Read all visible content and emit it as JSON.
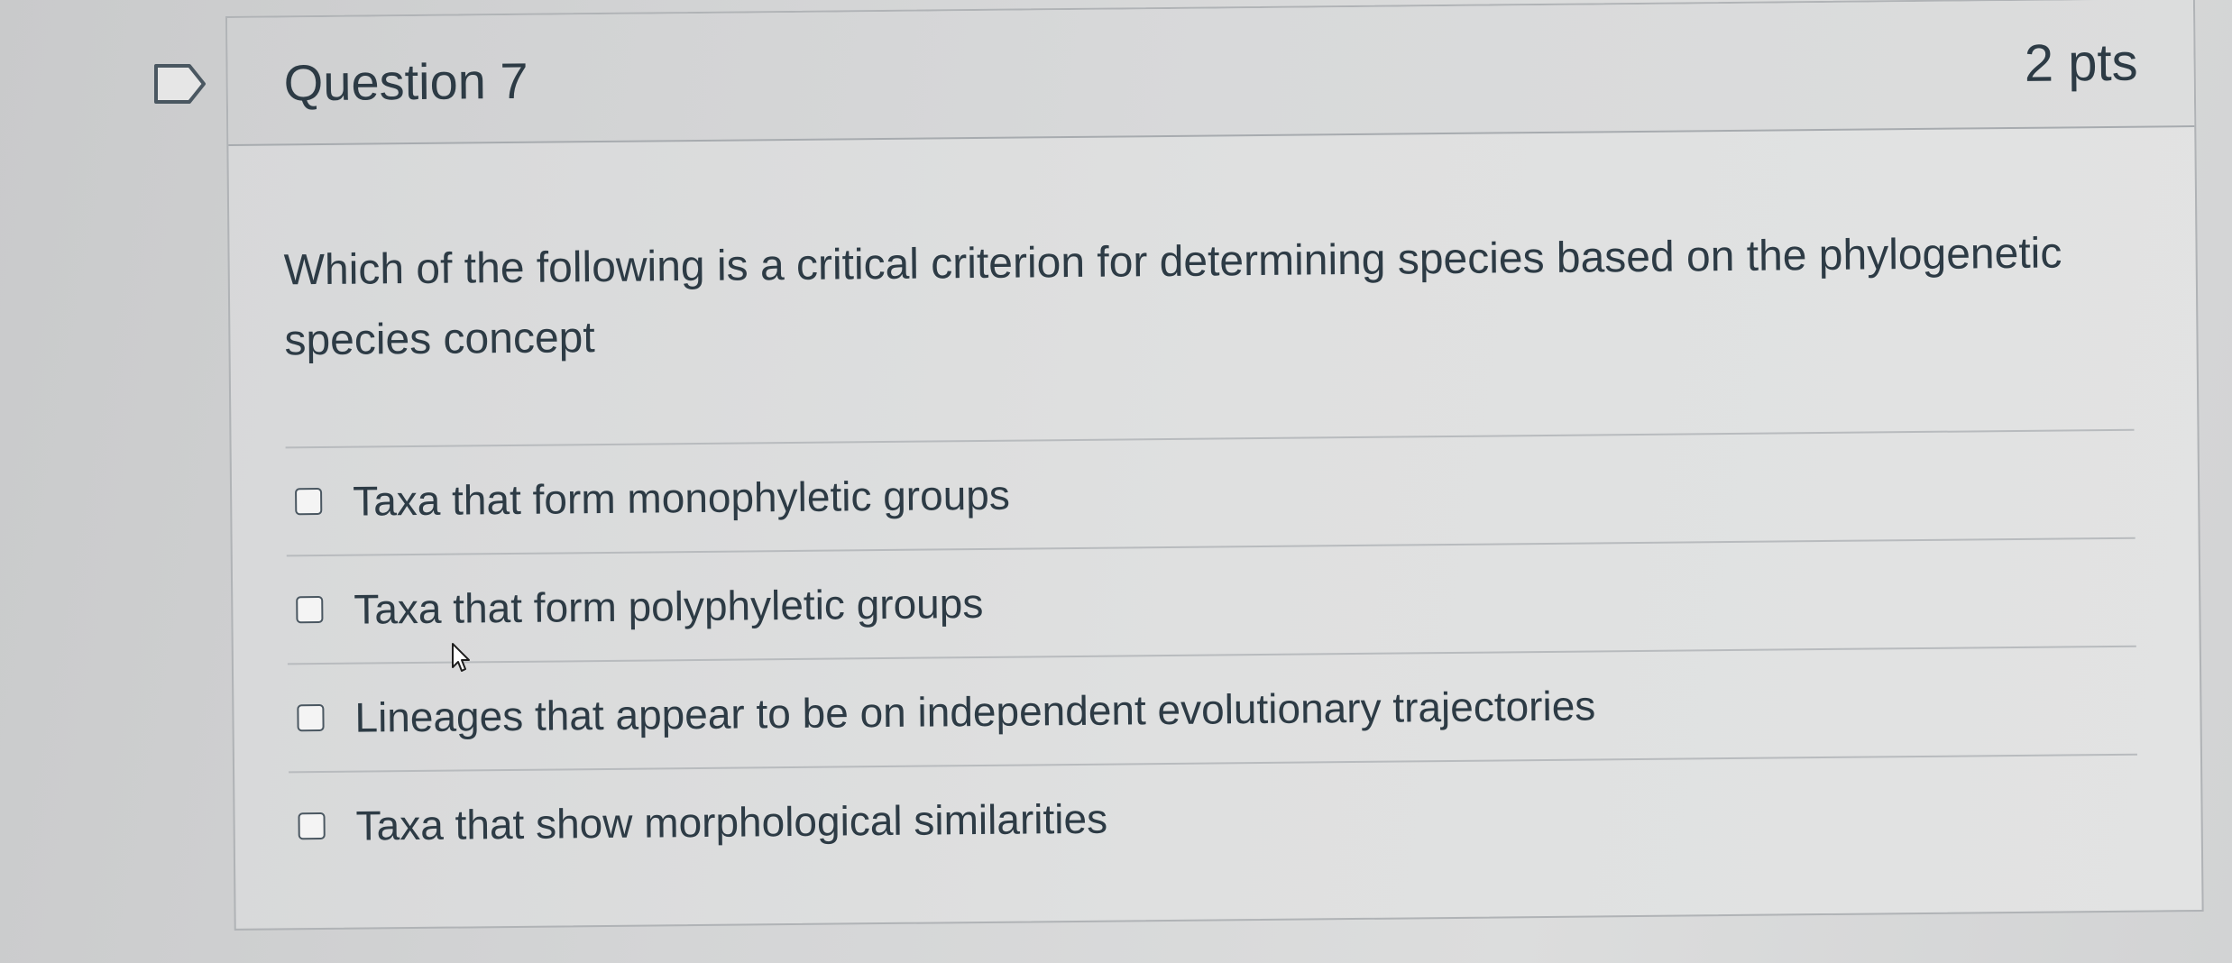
{
  "question": {
    "title": "Question 7",
    "points": "2 pts",
    "text": "Which of the following is a critical criterion for determining species based on the phylogenetic species concept"
  },
  "answers": [
    {
      "label": "Taxa that form monophyletic groups",
      "checked": false
    },
    {
      "label": "Taxa that form polyphyletic groups",
      "checked": false
    },
    {
      "label": "Lineages that appear to be on independent evolutionary trajectories",
      "checked": false
    },
    {
      "label": "Taxa that show morphological similarities",
      "checked": false
    }
  ],
  "icons": {
    "flag": "bookmark-flag-icon",
    "cursor": "mouse-pointer-icon"
  },
  "colors": {
    "text": "#2d3b45",
    "border": "#b0b3b6"
  }
}
